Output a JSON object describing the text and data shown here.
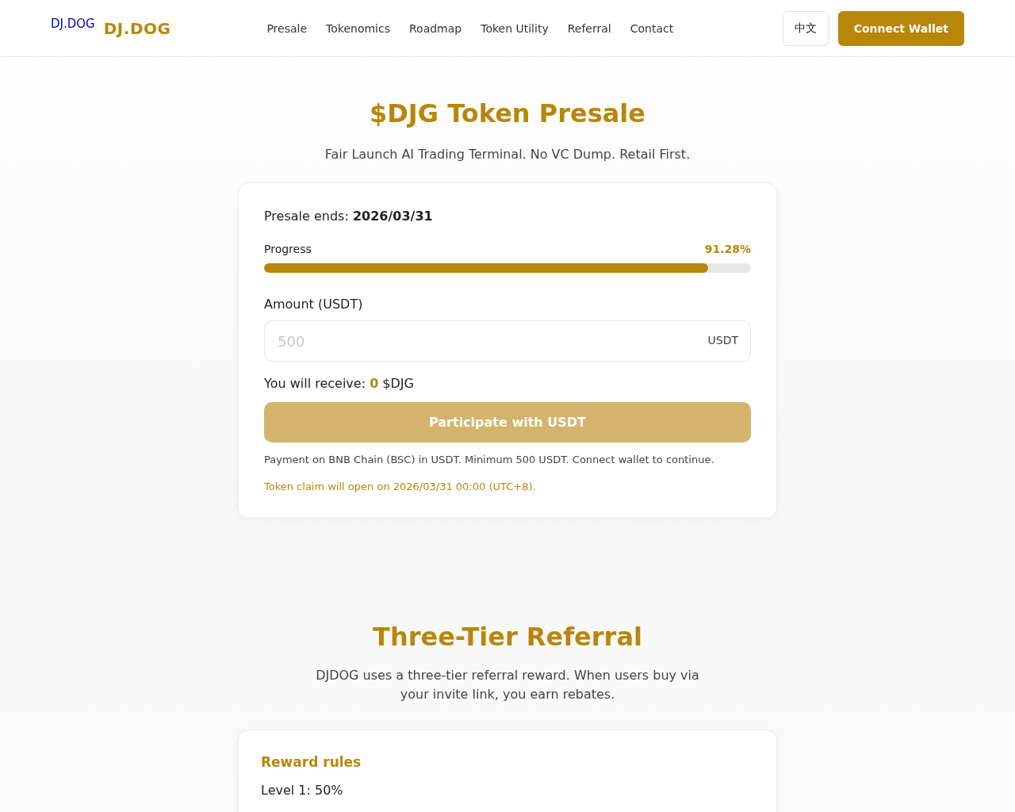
{
  "header": {
    "logo_alt": "DJ.DOG",
    "brand": "DJ.DOG",
    "nav": [
      {
        "label": "Presale"
      },
      {
        "label": "Tokenomics"
      },
      {
        "label": "Roadmap"
      },
      {
        "label": "Token Utility"
      },
      {
        "label": "Referral"
      },
      {
        "label": "Contact"
      }
    ],
    "language_button": "中文",
    "connect_button": "Connect Wallet"
  },
  "presale": {
    "title": "$DJG Token Presale",
    "subtitle": "Fair Launch AI Trading Terminal. No VC Dump. Retail First.",
    "ends_label": "Presale ends:",
    "ends_date": "2026/03/31",
    "progress": {
      "label": "Progress",
      "reading": "91.28%",
      "level": 0.9128
    },
    "amount_label": "Amount (USDT)",
    "amount": {
      "placeholder": "500",
      "unit": "USDT"
    },
    "receive_label": "You will receive:",
    "receive_value": "0",
    "receive_unit": "$DJG",
    "participate_button": {
      "label": "Participate with USDT",
      "disabled": true
    },
    "payment_note": "Payment on BNB Chain (BSC) in USDT. Minimum 500 USDT. Connect wallet to continue.",
    "claim_note": "Token claim will open on 2026/03/31 00:00 (UTC+8)."
  },
  "referral": {
    "title": "Three-Tier Referral",
    "description": "DJDOG uses a three-tier referral reward. When users buy via your invite link, you earn rebates.",
    "rules_title": "Reward rules",
    "rules": [
      "Level 1: 50%"
    ]
  }
}
